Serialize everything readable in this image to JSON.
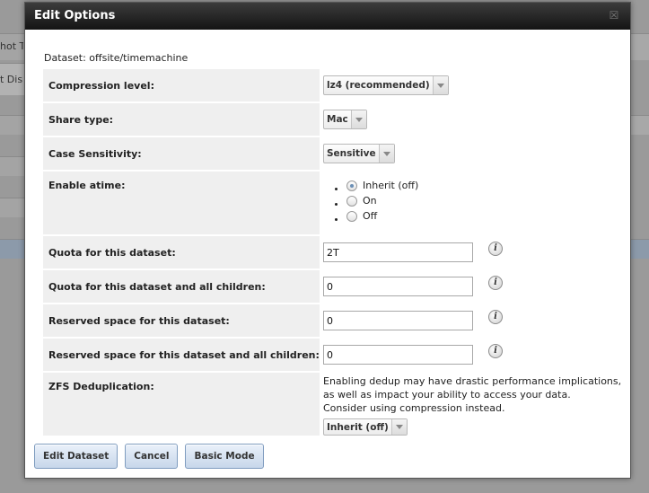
{
  "background": {
    "texts": [
      "hot T",
      "t Dis"
    ]
  },
  "dialog": {
    "title": "Edit Options",
    "close_icon": "close-icon",
    "dataset_label": "Dataset: offsite/timemachine"
  },
  "form": {
    "compression": {
      "label": "Compression level:",
      "value": "lz4 (recommended)"
    },
    "share_type": {
      "label": "Share type:",
      "value": "Mac"
    },
    "case_sensitivity": {
      "label": "Case Sensitivity:",
      "value": "Sensitive"
    },
    "atime": {
      "label": "Enable atime:",
      "options": [
        "Inherit (off)",
        "On",
        "Off"
      ],
      "selected": "Inherit (off)"
    },
    "quota": {
      "label": "Quota for this dataset:",
      "value": "2T"
    },
    "quota_children": {
      "label": "Quota for this dataset and all children:",
      "value": "0"
    },
    "reserved": {
      "label": "Reserved space for this dataset:",
      "value": "0"
    },
    "reserved_children": {
      "label": "Reserved space for this dataset and all children:",
      "value": "0"
    },
    "dedup": {
      "label": "ZFS Deduplication:",
      "warning_line1": "Enabling dedup may have drastic performance implications,",
      "warning_line2": "as well as impact your ability to access your data.",
      "warning_line3": "Consider using compression instead.",
      "value": "Inherit (off)"
    },
    "info_icon_char": "i"
  },
  "buttons": {
    "edit_dataset": "Edit Dataset",
    "cancel": "Cancel",
    "basic_mode": "Basic Mode"
  }
}
